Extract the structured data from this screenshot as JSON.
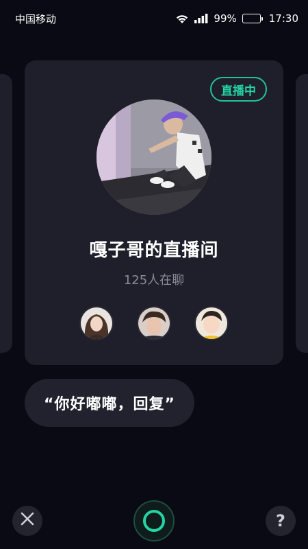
{
  "status_bar": {
    "carrier": "中国移动",
    "battery_percent": "99%",
    "time": "17:30"
  },
  "room_card": {
    "live_badge": "直播中",
    "title": "嘎子哥的直播间",
    "listener_count": "125人在聊",
    "host_avatar": "host-avatar-photo",
    "members": [
      "member-avatar-1",
      "member-avatar-2",
      "member-avatar-3"
    ]
  },
  "voice_prompt": {
    "text": "“你好嘟嘟，回复”"
  },
  "controls": {
    "close_icon": "close-icon",
    "mic_icon": "mic-ring-icon",
    "help_label": "?"
  },
  "colors": {
    "background": "#0a0a14",
    "card": "#1f1f2b",
    "accent": "#25d3a4"
  }
}
